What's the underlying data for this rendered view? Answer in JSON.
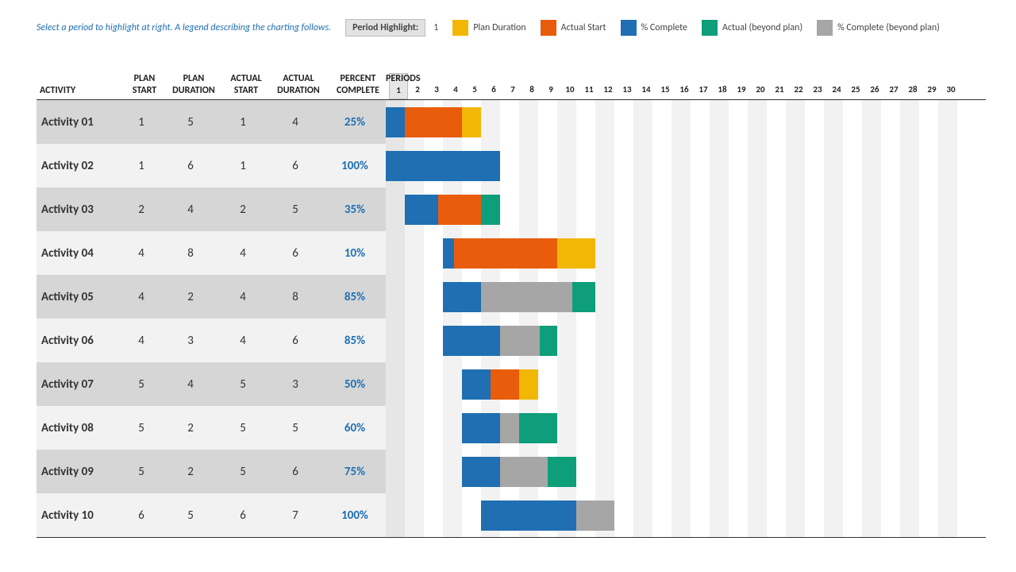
{
  "hint_text": "Select a period to highlight at right.  A legend describing the charting follows.",
  "period_label": "Period Highlight:",
  "period_value": "1",
  "legend": {
    "plan_duration": "Plan Duration",
    "actual_start": "Actual Start",
    "percent_complete": "% Complete",
    "actual_beyond": "Actual (beyond plan)",
    "percent_beyond": "% Complete (beyond plan)"
  },
  "colors": {
    "plan_duration": "#F2B705",
    "actual_start": "#E85C0C",
    "percent_complete": "#1F6FB2",
    "actual_beyond": "#0E9E7A",
    "percent_beyond": "#A6A6A6",
    "highlight_bg": "#e6e6e6"
  },
  "columns": {
    "activity": "ACTIVITY",
    "plan_start_1": "PLAN",
    "plan_start_2": "START",
    "plan_dur_1": "PLAN",
    "plan_dur_2": "DURATION",
    "actual_start_1": "ACTUAL",
    "actual_start_2": "START",
    "actual_dur_1": "ACTUAL",
    "actual_dur_2": "DURATION",
    "pct_1": "PERCENT",
    "pct_2": "COMPLETE",
    "periods": "PERIODS"
  },
  "num_periods": 30,
  "period_highlight": 1,
  "rows": [
    {
      "activity": "Activity 01",
      "plan_start": 1,
      "plan_dur": 5,
      "actual_start": 1,
      "actual_dur": 4,
      "percent": "25%"
    },
    {
      "activity": "Activity 02",
      "plan_start": 1,
      "plan_dur": 6,
      "actual_start": 1,
      "actual_dur": 6,
      "percent": "100%"
    },
    {
      "activity": "Activity 03",
      "plan_start": 2,
      "plan_dur": 4,
      "actual_start": 2,
      "actual_dur": 5,
      "percent": "35%"
    },
    {
      "activity": "Activity 04",
      "plan_start": 4,
      "plan_dur": 8,
      "actual_start": 4,
      "actual_dur": 6,
      "percent": "10%"
    },
    {
      "activity": "Activity 05",
      "plan_start": 4,
      "plan_dur": 2,
      "actual_start": 4,
      "actual_dur": 8,
      "percent": "85%"
    },
    {
      "activity": "Activity 06",
      "plan_start": 4,
      "plan_dur": 3,
      "actual_start": 4,
      "actual_dur": 6,
      "percent": "85%"
    },
    {
      "activity": "Activity 07",
      "plan_start": 5,
      "plan_dur": 4,
      "actual_start": 5,
      "actual_dur": 3,
      "percent": "50%"
    },
    {
      "activity": "Activity 08",
      "plan_start": 5,
      "plan_dur": 2,
      "actual_start": 5,
      "actual_dur": 5,
      "percent": "60%"
    },
    {
      "activity": "Activity 09",
      "plan_start": 5,
      "plan_dur": 2,
      "actual_start": 5,
      "actual_dur": 6,
      "percent": "75%"
    },
    {
      "activity": "Activity 10",
      "plan_start": 6,
      "plan_dur": 5,
      "actual_start": 6,
      "actual_dur": 7,
      "percent": "100%"
    }
  ],
  "chart_data": {
    "type": "table",
    "title": "Project Planner Gantt",
    "xlabel": "Periods",
    "ylabel": "Activity",
    "periods": [
      1,
      2,
      3,
      4,
      5,
      6,
      7,
      8,
      9,
      10,
      11,
      12,
      13,
      14,
      15,
      16,
      17,
      18,
      19,
      20,
      21,
      22,
      23,
      24,
      25,
      26,
      27,
      28,
      29,
      30
    ],
    "legend": [
      "Plan Duration",
      "Actual Start",
      "% Complete",
      "Actual (beyond plan)",
      "% Complete (beyond plan)"
    ],
    "rows": [
      {
        "activity": "Activity 01",
        "plan_start": 1,
        "plan_duration": 5,
        "actual_start": 1,
        "actual_duration": 4,
        "percent_complete": 25
      },
      {
        "activity": "Activity 02",
        "plan_start": 1,
        "plan_duration": 6,
        "actual_start": 1,
        "actual_duration": 6,
        "percent_complete": 100
      },
      {
        "activity": "Activity 03",
        "plan_start": 2,
        "plan_duration": 4,
        "actual_start": 2,
        "actual_duration": 5,
        "percent_complete": 35
      },
      {
        "activity": "Activity 04",
        "plan_start": 4,
        "plan_duration": 8,
        "actual_start": 4,
        "actual_duration": 6,
        "percent_complete": 10
      },
      {
        "activity": "Activity 05",
        "plan_start": 4,
        "plan_duration": 2,
        "actual_start": 4,
        "actual_duration": 8,
        "percent_complete": 85
      },
      {
        "activity": "Activity 06",
        "plan_start": 4,
        "plan_duration": 3,
        "actual_start": 4,
        "actual_duration": 6,
        "percent_complete": 85
      },
      {
        "activity": "Activity 07",
        "plan_start": 5,
        "plan_duration": 4,
        "actual_start": 5,
        "actual_duration": 3,
        "percent_complete": 50
      },
      {
        "activity": "Activity 08",
        "plan_start": 5,
        "plan_duration": 2,
        "actual_start": 5,
        "actual_duration": 5,
        "percent_complete": 60
      },
      {
        "activity": "Activity 09",
        "plan_start": 5,
        "plan_duration": 2,
        "actual_start": 5,
        "actual_duration": 6,
        "percent_complete": 75
      },
      {
        "activity": "Activity 10",
        "plan_start": 6,
        "plan_duration": 5,
        "actual_start": 6,
        "actual_duration": 7,
        "percent_complete": 100
      }
    ]
  }
}
